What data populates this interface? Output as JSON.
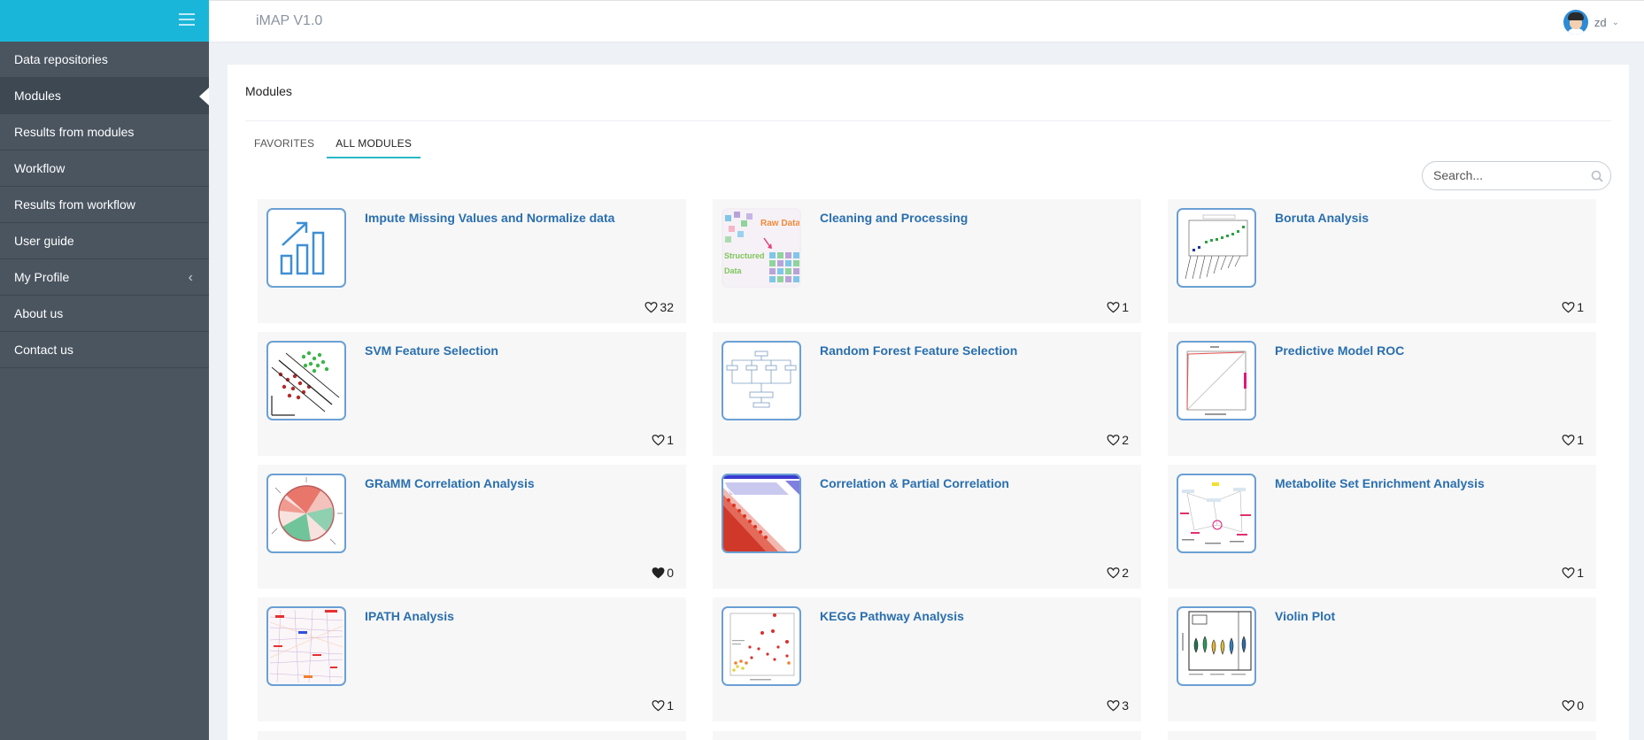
{
  "app": {
    "title": "iMAP V1.0"
  },
  "user": {
    "name": "zd"
  },
  "sidebar": {
    "items": [
      {
        "label": "Data repositories"
      },
      {
        "label": "Modules"
      },
      {
        "label": "Results from modules"
      },
      {
        "label": "Workflow"
      },
      {
        "label": "Results from workflow"
      },
      {
        "label": "User guide"
      },
      {
        "label": "My Profile"
      },
      {
        "label": "About us"
      },
      {
        "label": "Contact us"
      }
    ],
    "active_index": 1
  },
  "panel": {
    "title": "Modules"
  },
  "tabs": [
    {
      "label": "FAVORITES"
    },
    {
      "label": "ALL MODULES"
    }
  ],
  "active_tab": 1,
  "search": {
    "placeholder": "Search..."
  },
  "modules": [
    {
      "title": "Impute Missing Values and Normalize data",
      "likes": "32",
      "liked": false,
      "icon": "bar-chart-up-icon"
    },
    {
      "title": "Cleaning and Processing",
      "likes": "1",
      "liked": false,
      "icon": "raw-structured-data-icon",
      "thumb_text": [
        "Raw Data",
        "Structured",
        "Data"
      ]
    },
    {
      "title": "Boruta Analysis",
      "likes": "1",
      "liked": false,
      "icon": "boruta-plot-icon"
    },
    {
      "title": "SVM Feature Selection",
      "likes": "1",
      "liked": false,
      "icon": "svm-scatter-icon"
    },
    {
      "title": "Random Forest Feature Selection",
      "likes": "2",
      "liked": false,
      "icon": "decision-tree-icon"
    },
    {
      "title": "Predictive Model ROC",
      "likes": "1",
      "liked": false,
      "icon": "roc-curve-icon"
    },
    {
      "title": "GRaMM Correlation Analysis",
      "likes": "0",
      "liked": true,
      "icon": "chord-diagram-icon"
    },
    {
      "title": "Correlation & Partial Correlation",
      "likes": "2",
      "liked": false,
      "icon": "correlation-matrix-icon"
    },
    {
      "title": "Metabolite Set Enrichment Analysis",
      "likes": "1",
      "liked": false,
      "icon": "enrichment-network-icon"
    },
    {
      "title": "IPATH Analysis",
      "likes": "1",
      "liked": false,
      "icon": "pathway-map-icon"
    },
    {
      "title": "KEGG Pathway Analysis",
      "likes": "3",
      "liked": false,
      "icon": "kegg-scatter-icon"
    },
    {
      "title": "Violin Plot",
      "likes": "0",
      "liked": false,
      "icon": "violin-plot-icon"
    }
  ],
  "colors": {
    "accent": "#1ab6d9",
    "sidebar": "#4a5560",
    "link": "#2a6fae",
    "tab_underline": "#2ab7c9"
  }
}
